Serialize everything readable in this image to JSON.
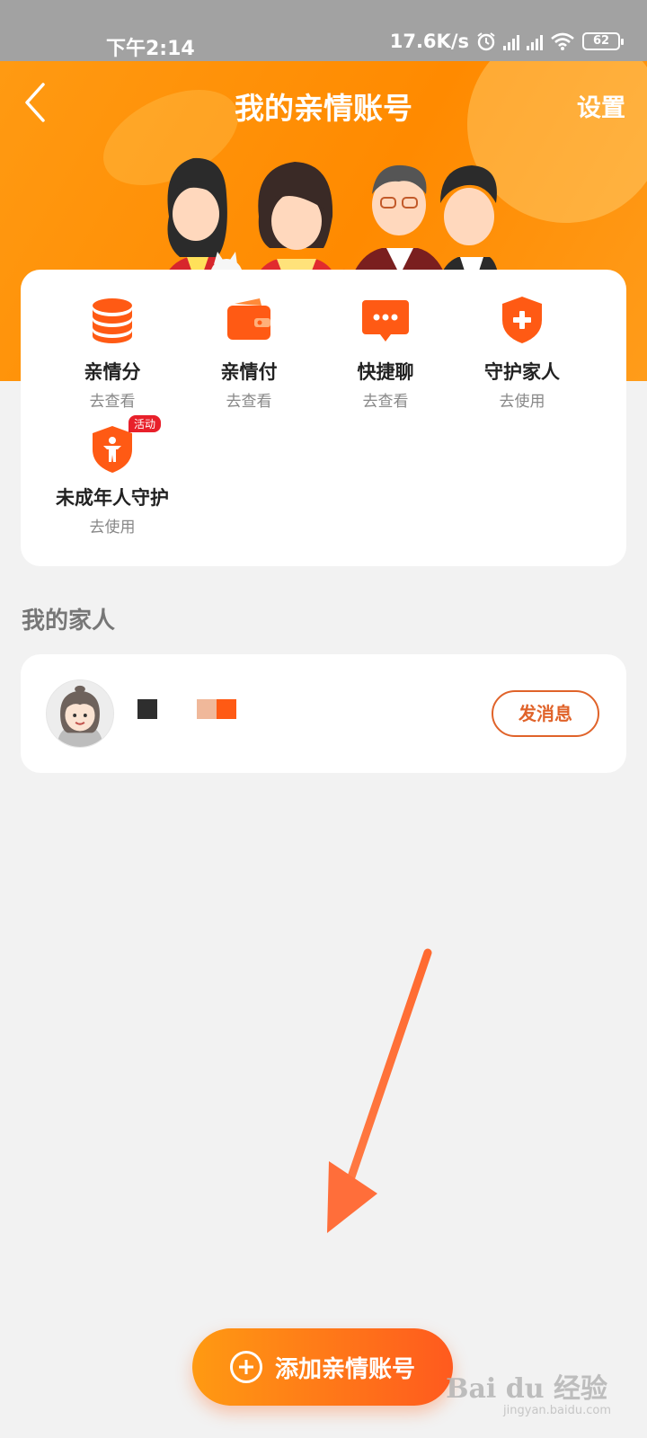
{
  "status_bar": {
    "time": "下午2:14",
    "net_speed": "17.6K/s",
    "battery": "62"
  },
  "header": {
    "title": "我的亲情账号",
    "settings_label": "设置",
    "back_icon": "chevron-left-icon",
    "background_color": "#ff9000"
  },
  "features": [
    {
      "label": "亲情分",
      "sub": "去查看",
      "icon": "coin-stack-icon"
    },
    {
      "label": "亲情付",
      "sub": "去查看",
      "icon": "wallet-icon"
    },
    {
      "label": "快捷聊",
      "sub": "去查看",
      "icon": "chat-bubble-icon"
    },
    {
      "label": "守护家人",
      "sub": "去使用",
      "icon": "shield-plus-icon"
    },
    {
      "label": "未成年人守护",
      "sub": "去使用",
      "icon": "shield-child-icon",
      "badge": "活动"
    }
  ],
  "family": {
    "section_title": "我的家人",
    "members": [
      {
        "message_label": "发消息"
      }
    ]
  },
  "add_button_label": "添加亲情账号",
  "watermark": {
    "brand": "Bai du 经验",
    "url": "jingyan.baidu.com"
  },
  "colors": {
    "accent": "#ff5a1e",
    "orange": "#ff9000",
    "message_border": "#e0632a"
  }
}
